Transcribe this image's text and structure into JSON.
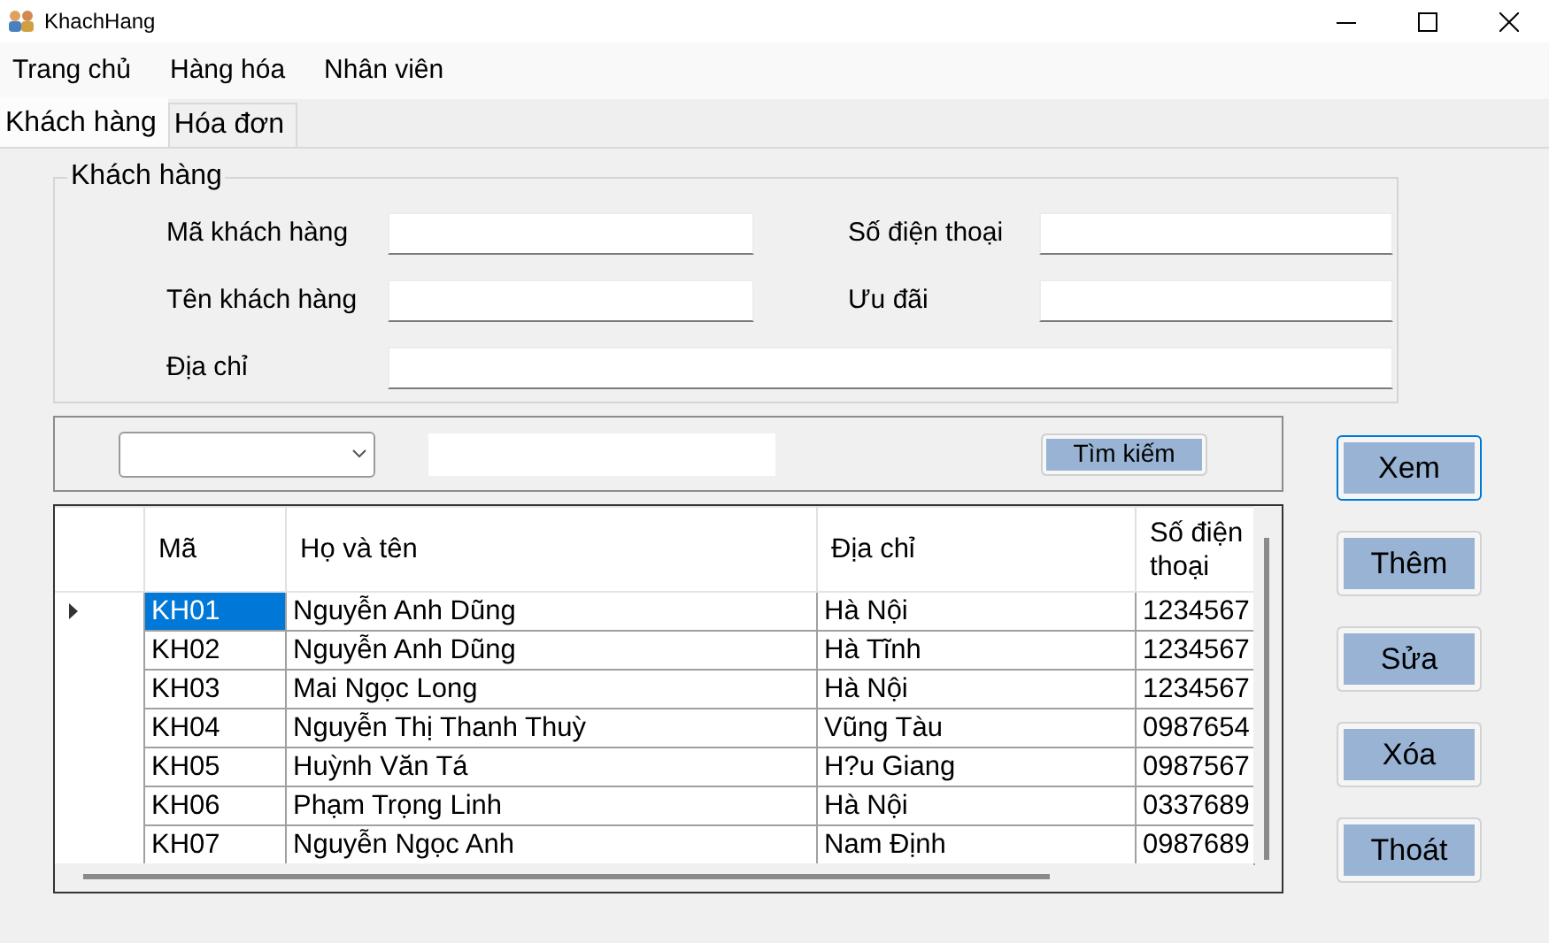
{
  "window": {
    "title": "KhachHang"
  },
  "menu": [
    {
      "label": "Trang chủ"
    },
    {
      "label": "Hàng hóa"
    },
    {
      "label": "Nhân viên"
    }
  ],
  "tabs": [
    {
      "label": "Khách hàng",
      "selected": true
    },
    {
      "label": "Hóa đơn",
      "selected": false
    }
  ],
  "customer_group": {
    "title": "Khách hàng",
    "fields": [
      {
        "label": "Mã khách hàng",
        "kind": "short"
      },
      {
        "label": "Số điện thoại",
        "kind": "short"
      },
      {
        "label": "Tên khách hàng",
        "kind": "short"
      },
      {
        "label": "Ưu đãi",
        "kind": "short"
      },
      {
        "label": "Địa chỉ",
        "kind": "wide"
      }
    ]
  },
  "search": {
    "button": "Tìm kiếm"
  },
  "grid": {
    "columns": [
      "Mã",
      "Họ và tên",
      "Địa chỉ",
      "Số điện thoại"
    ],
    "rows": [
      {
        "cells": [
          "KH01",
          "Nguyễn Anh Dũng",
          "Hà Nội",
          "1234567"
        ],
        "selected": true
      },
      {
        "cells": [
          "KH02",
          "Nguyễn Anh Dũng",
          "Hà Tĩnh",
          "1234567"
        ],
        "selected": false
      },
      {
        "cells": [
          "KH03",
          "Mai Ngọc Long",
          "Hà Nội",
          "1234567"
        ],
        "selected": false
      },
      {
        "cells": [
          "KH04",
          "Nguyễn Thị Thanh Thuỳ",
          "Vũng Tàu",
          "0987654"
        ],
        "selected": false
      },
      {
        "cells": [
          "KH05",
          "Huỳnh Văn Tá",
          "H?u Giang",
          "0987567"
        ],
        "selected": false
      },
      {
        "cells": [
          "KH06",
          "Phạm Trọng Linh",
          "Hà Nội",
          "0337689"
        ],
        "selected": false
      },
      {
        "cells": [
          "KH07",
          "Nguyễn Ngọc Anh",
          "Nam Định",
          "0987689"
        ],
        "selected": false
      }
    ]
  },
  "buttons": [
    {
      "label": "Xem",
      "focused": true
    },
    {
      "label": "Thêm",
      "focused": false
    },
    {
      "label": "Sửa",
      "focused": false
    },
    {
      "label": "Xóa",
      "focused": false
    },
    {
      "label": "Thoát",
      "focused": false
    }
  ]
}
